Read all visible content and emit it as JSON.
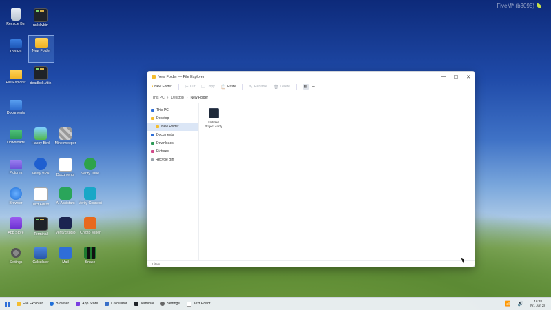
{
  "watermark": "FiveM* (b3095)",
  "desktop_icons": [
    {
      "label": "Recycle Bin",
      "icon": "recycle-bin-icon"
    },
    {
      "label": "ratlckvbin",
      "icon": "terminal-icon"
    },
    {
      "label": "This PC",
      "icon": "computer-icon"
    },
    {
      "label": "New Folder",
      "icon": "folder-icon"
    },
    {
      "label": "File Explorer",
      "icon": "folder-icon"
    },
    {
      "label": "deadbolt.vbin",
      "icon": "terminal-icon"
    },
    {
      "label": "Documents",
      "icon": "documents-folder-icon"
    },
    {
      "label": "Downloads",
      "icon": "downloads-folder-icon"
    },
    {
      "label": "Happy Bird",
      "icon": "game-icon"
    },
    {
      "label": "Minesweeper",
      "icon": "minesweeper-icon"
    },
    {
      "label": "Pictures",
      "icon": "pictures-folder-icon"
    },
    {
      "label": "Verity VPN",
      "icon": "vpn-icon"
    },
    {
      "label": "Documents",
      "icon": "document-icon"
    },
    {
      "label": "Verity Tune",
      "icon": "music-icon"
    },
    {
      "label": "Browser",
      "icon": "globe-icon"
    },
    {
      "label": "Text Editor",
      "icon": "text-file-icon"
    },
    {
      "label": "AI Assistant",
      "icon": "chat-icon"
    },
    {
      "label": "Verity Connect",
      "icon": "connect-icon"
    },
    {
      "label": "App Store",
      "icon": "store-icon"
    },
    {
      "label": "Terminal",
      "icon": "terminal-icon"
    },
    {
      "label": "Verity Studio",
      "icon": "studio-icon"
    },
    {
      "label": "Crypto Miner",
      "icon": "miner-icon"
    },
    {
      "label": "Settings",
      "icon": "gear-icon"
    },
    {
      "label": "Calculator",
      "icon": "calculator-icon"
    },
    {
      "label": "Mail",
      "icon": "mail-icon"
    },
    {
      "label": "Snake",
      "icon": "snake-icon"
    }
  ],
  "window": {
    "title": "New Folder — File Explorer",
    "controls": {
      "minimize": "—",
      "maximize": "☐",
      "close": "✕"
    },
    "toolbar": {
      "new_folder": "New Folder",
      "cut": "Cut",
      "copy": "Copy",
      "paste": "Paste",
      "rename": "Rename",
      "delete": "Delete"
    },
    "breadcrumb": [
      "This PC",
      "Desktop",
      "New Folder"
    ],
    "breadcrumb_sep": "›",
    "sidebar": [
      {
        "label": "This PC",
        "color": "#2f6fd8"
      },
      {
        "label": "Desktop",
        "color": "#f4bd2f"
      },
      {
        "label": "New Folder",
        "color": "#f4bd2f"
      },
      {
        "label": "Documents",
        "color": "#2f6fd8"
      },
      {
        "label": "Downloads",
        "color": "#2e9a57"
      },
      {
        "label": "Pictures",
        "color": "#d04a8a"
      },
      {
        "label": "Recycle Bin",
        "color": "#9aa3ad"
      }
    ],
    "files": [
      {
        "name": "Untitled Project.conly"
      }
    ],
    "status": "1 item"
  },
  "taskbar": {
    "items": [
      "File Explorer",
      "Browser",
      "App Store",
      "Calculator",
      "Terminal",
      "Settings",
      "Text Editor"
    ],
    "time": "16:28",
    "date": "Fr., Jun 28"
  }
}
